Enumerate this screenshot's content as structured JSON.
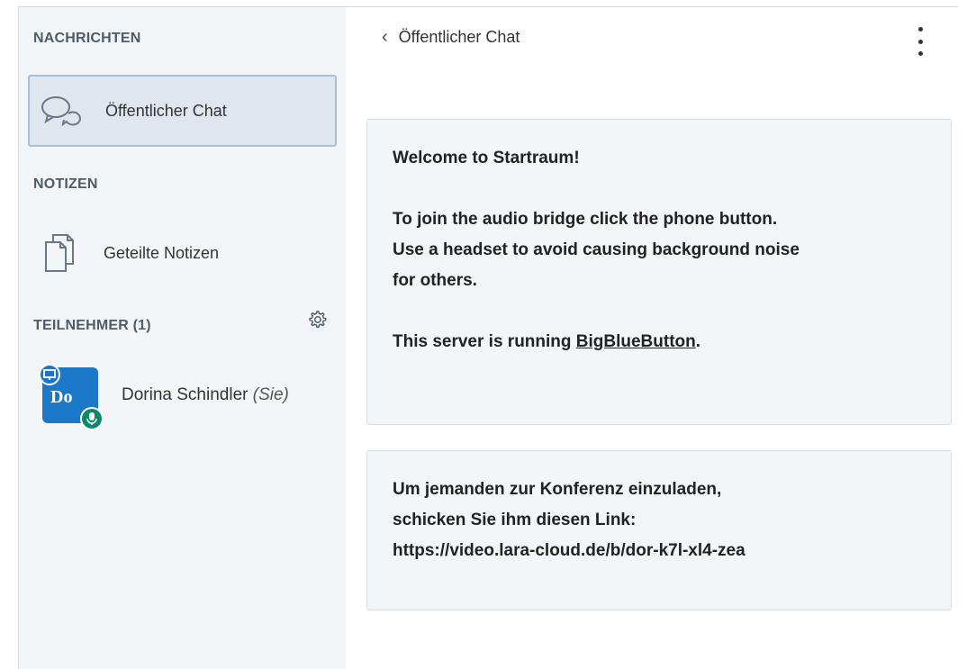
{
  "sidebar": {
    "messages_title": "NACHRICHTEN",
    "public_chat_label": "Öffentlicher Chat",
    "notes_title": "NOTIZEN",
    "shared_notes_label": "Geteilte Notizen",
    "participants_title": "TEILNEHMER (1)",
    "user": {
      "initials": "Do",
      "name": "Dorina Schindler",
      "you_label": "(Sie)"
    }
  },
  "chat": {
    "title": "Öffentlicher Chat",
    "welcome": {
      "line1_prefix": "Welcome to ",
      "line1_room": "Startraum",
      "line1_suffix": "!",
      "line2": "To join the audio bridge click the phone button.",
      "line3": "Use a headset to avoid causing background noise",
      "line4": "for others.",
      "line5_prefix": "This server is running ",
      "line5_link": "BigBlueButton",
      "line5_suffix": "."
    },
    "invite": {
      "line1": "Um jemanden zur Konferenz einzuladen,",
      "line2": "schicken Sie ihm diesen Link:",
      "link": "https://video.lara-cloud.de/b/dor-k7l-xl4-zea"
    }
  },
  "colors": {
    "sidebar_bg": "#f3f6f9",
    "avatar": "#1b78c9",
    "mic_badge": "#0a8a6a"
  }
}
